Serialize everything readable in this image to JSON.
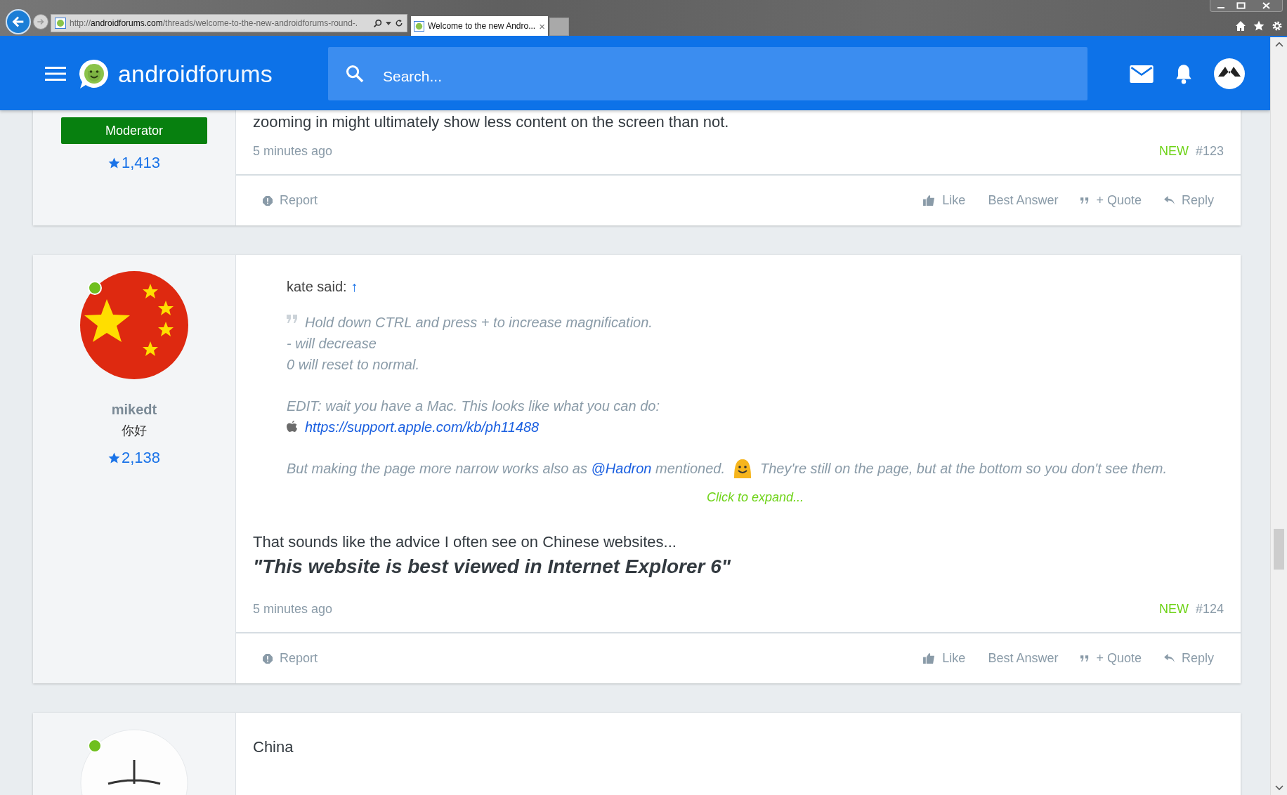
{
  "browser": {
    "url_scheme": "http://",
    "url_host": "androidforums.com",
    "url_path": "/threads/welcome-to-the-new-androidforums-round-.",
    "tab_title": "Welcome to the new Andro...",
    "tab_close": "×"
  },
  "site": {
    "logo_main": "android",
    "logo_sub": "forums",
    "search_placeholder": "Search..."
  },
  "posts": [
    {
      "user": {
        "role": "Moderator",
        "points": "1,413"
      },
      "body": [
        {
          "kind": "text",
          "text": "zooming in might ultimately show less content on the screen than not."
        }
      ],
      "meta": {
        "time": "5 minutes ago",
        "new": "NEW",
        "number": "#123"
      },
      "actions": [
        {
          "kind": "report",
          "label": "Report"
        },
        {
          "kind": "like",
          "label": "Like"
        },
        {
          "kind": "plain",
          "label": "Best Answer"
        },
        {
          "kind": "quote",
          "label": "+ Quote"
        },
        {
          "kind": "reply",
          "label": "Reply"
        }
      ]
    },
    {
      "user": {
        "avatar": {
          "kind": "flag"
        },
        "online": true,
        "name": "mikedt",
        "title": "你好",
        "points": "2,138"
      },
      "body": [
        {
          "kind": "quote",
          "author": "kate said:",
          "jump": "↑",
          "lines": [
            "Hold down CTRL and press + to increase magnification.",
            "- will decrease",
            "0 will reset to normal."
          ],
          "edit": "EDIT: wait you have a Mac. This looks like what you can do:",
          "link": "https://support.apple.com/kb/ph11488",
          "last_before": "But making the page more narrow works also as ",
          "mention": "@Hadron",
          "last_mid": " mentioned.",
          "last_after": "They're still on the page, but at the bottom so you don't see them.",
          "expand": "Click to expand..."
        },
        {
          "kind": "text",
          "text": "That sounds like the advice I often see on Chinese websites..."
        },
        {
          "kind": "emphasis",
          "text": "\"This website is best viewed in Internet Explorer 6\""
        }
      ],
      "meta": {
        "time": "5 minutes ago",
        "new": "NEW",
        "number": "#124"
      },
      "actions": [
        {
          "kind": "report",
          "label": "Report"
        },
        {
          "kind": "like",
          "label": "Like"
        },
        {
          "kind": "plain",
          "label": "Best Answer"
        },
        {
          "kind": "quote",
          "label": "+ Quote"
        },
        {
          "kind": "reply",
          "label": "Reply"
        }
      ]
    },
    {
      "user": {
        "avatar": {
          "kind": "sketch"
        },
        "online": true
      },
      "body": [
        {
          "kind": "text",
          "text": "China"
        }
      ]
    }
  ]
}
